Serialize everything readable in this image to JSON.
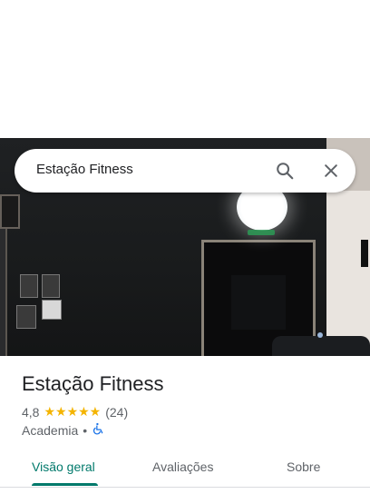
{
  "search": {
    "query": "Estação Fitness",
    "search_icon": "search-icon",
    "close_icon": "close-icon"
  },
  "place": {
    "name": "Estação Fitness",
    "rating": "4,8",
    "stars": "★★★★★",
    "review_count": "(24)",
    "category": "Academia",
    "separator": "•",
    "accessibility_icon": "wheelchair-icon"
  },
  "tabs": [
    {
      "label": "Visão geral",
      "active": true
    },
    {
      "label": "Avaliações",
      "active": false
    },
    {
      "label": "Sobre",
      "active": false
    }
  ],
  "colors": {
    "accent": "#00796b",
    "star": "#f4b400",
    "accessibility": "#1a73e8"
  }
}
